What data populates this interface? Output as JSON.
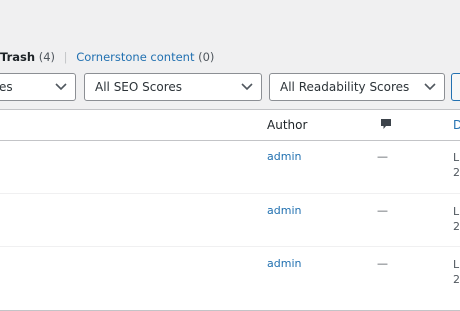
{
  "views": {
    "trash": {
      "label": "Trash",
      "count": "(4)"
    },
    "separator": "|",
    "cornerstone": {
      "label": "Cornerstone content",
      "count": "(0)"
    }
  },
  "filters": {
    "first_partial": "es",
    "seo": "All SEO Scores",
    "readability": "All Readability Scores"
  },
  "table": {
    "columns": {
      "author": "Author",
      "comments_icon": "comment-bubble-icon",
      "date_partial": "D"
    },
    "rows": [
      {
        "author": "admin",
        "comments": "—",
        "date_line1": "L",
        "date_line2": "2"
      },
      {
        "author": "admin",
        "comments": "—",
        "date_line1": "L",
        "date_line2": "2"
      },
      {
        "author": "admin",
        "comments": "—",
        "date_line1": "L",
        "date_line2": "2"
      }
    ]
  },
  "colors": {
    "link": "#2271b1",
    "background": "#f0f0f1",
    "border": "#c3c4c7"
  }
}
